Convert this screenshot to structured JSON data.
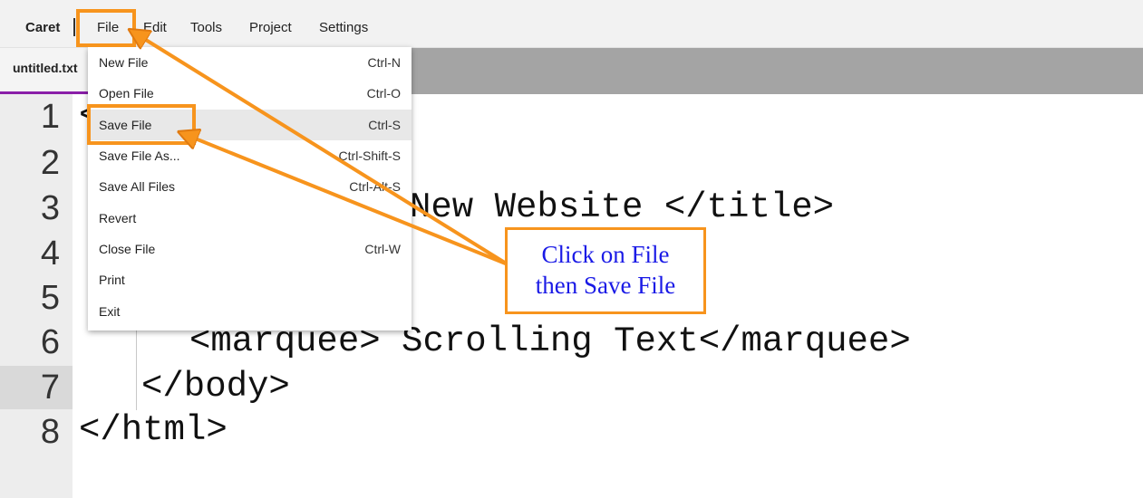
{
  "menubar": {
    "app_name": "Caret",
    "menus": [
      "File",
      "Edit",
      "Tools",
      "Project",
      "Settings"
    ]
  },
  "tab": {
    "label": "untitled.txt"
  },
  "editor": {
    "line_numbers": [
      "1",
      "2",
      "3",
      "4",
      "5",
      "6",
      "7",
      "8"
    ],
    "active_line": 7,
    "visible_code": {
      "line1": "<",
      "line3": "New Website </title>",
      "line6": "<marquee> Scrolling Text</marquee>",
      "line7": "</body>",
      "line8": "</html>"
    }
  },
  "file_menu": {
    "items": [
      {
        "label": "New File",
        "shortcut": "Ctrl-N"
      },
      {
        "label": "Open File",
        "shortcut": "Ctrl-O"
      },
      {
        "label": "Save File",
        "shortcut": "Ctrl-S"
      },
      {
        "label": "Save File As...",
        "shortcut": "Ctrl-Shift-S"
      },
      {
        "label": "Save All Files",
        "shortcut": "Ctrl-Alt-S"
      },
      {
        "label": "Revert",
        "shortcut": ""
      },
      {
        "label": "Close File",
        "shortcut": "Ctrl-W"
      },
      {
        "label": "Print",
        "shortcut": ""
      },
      {
        "label": "Exit",
        "shortcut": ""
      }
    ],
    "hovered_item": "Save File"
  },
  "annotation": {
    "line1": "Click on File",
    "line2": "then Save File",
    "highlight_color": "#f7941d",
    "text_color": "#1a1ae6"
  },
  "colors": {
    "tab_accent": "#8a1fa8",
    "tabbar_bg": "#a4a4a4"
  }
}
